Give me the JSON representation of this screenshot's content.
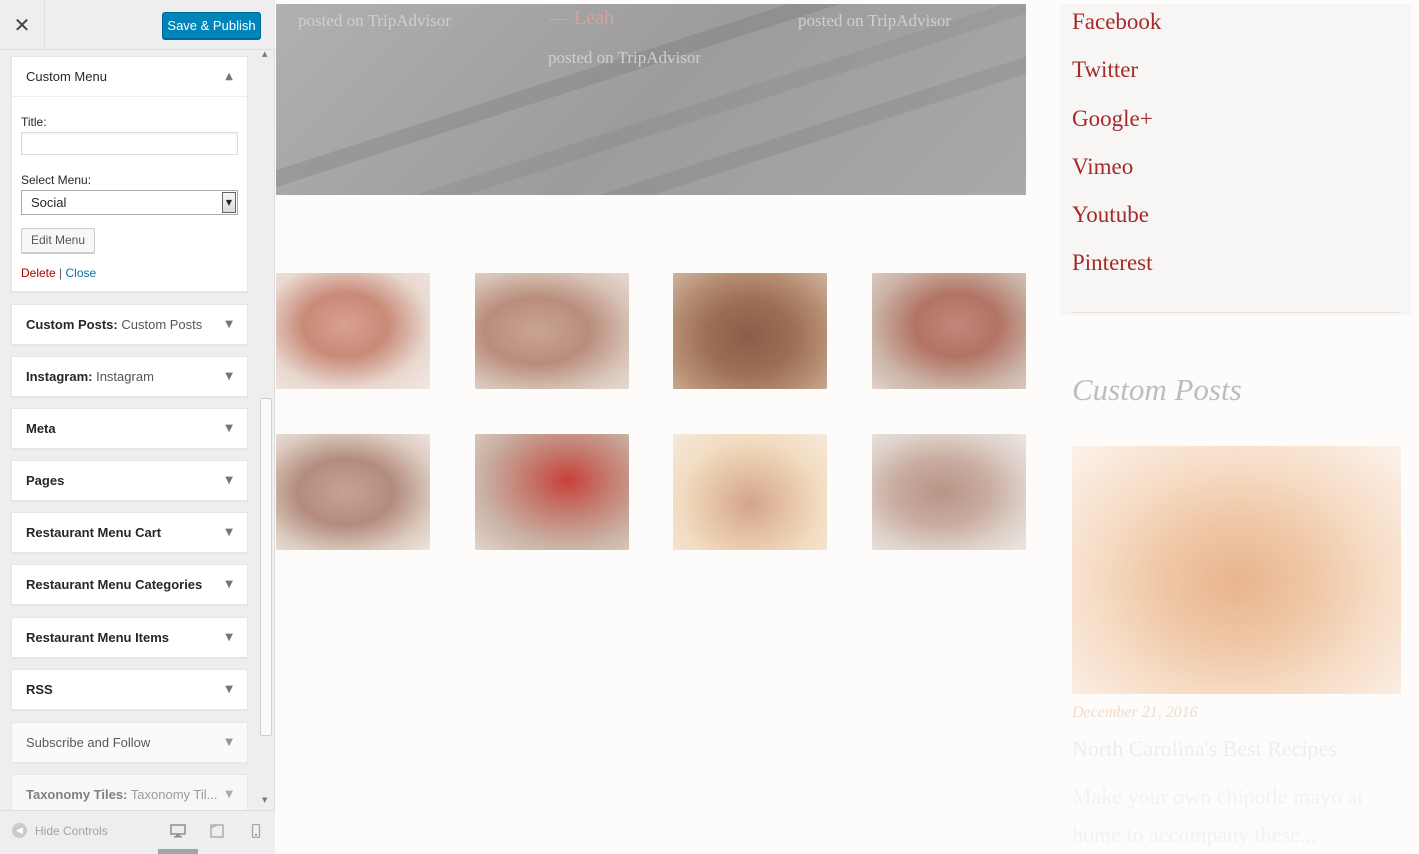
{
  "header": {
    "close_glyph": "✕",
    "publish_label": "Save & Publish"
  },
  "custom_menu": {
    "title": "Custom Menu",
    "title_label": "Title:",
    "title_value": "",
    "select_label": "Select Menu:",
    "select_value": "Social",
    "edit_button": "Edit Menu",
    "delete_link": "Delete",
    "separator": "|",
    "close_link": "Close"
  },
  "widgets": [
    {
      "name": "Custom Posts:",
      "sub": "Custom Posts"
    },
    {
      "name": "Instagram:",
      "sub": "Instagram"
    },
    {
      "name": "Meta",
      "sub": ""
    },
    {
      "name": "Pages",
      "sub": ""
    },
    {
      "name": "Restaurant Menu Cart",
      "sub": ""
    },
    {
      "name": "Restaurant Menu Categories",
      "sub": ""
    },
    {
      "name": "Restaurant Menu Items",
      "sub": ""
    },
    {
      "name": "RSS",
      "sub": ""
    },
    {
      "name": "Subscribe and Follow",
      "sub": ""
    },
    {
      "name": "Taxonomy Tiles:",
      "sub": "Taxonomy Til..."
    }
  ],
  "footer": {
    "hide_controls": "Hide Controls"
  },
  "preview": {
    "reviews": {
      "source_left": "posted on TripAdvisor",
      "author": "— Leah",
      "source_right": "posted on TripAdvisor",
      "source_center": "posted on TripAdvisor"
    },
    "social_links": [
      "Facebook",
      "Twitter",
      "Google+",
      "Vimeo",
      "Youtube",
      "Pinterest"
    ],
    "custom_posts": {
      "title": "Custom Posts",
      "date": "December 21, 2016",
      "heading": "North Carolina's Best Recipes",
      "excerpt": "Make your own chipotle mayo at home to accompany these..."
    }
  },
  "colors": {
    "accent": "#0085ba",
    "social_link": "#a42a2a",
    "delete_link": "#aa0000",
    "close_link": "#0073aa"
  }
}
